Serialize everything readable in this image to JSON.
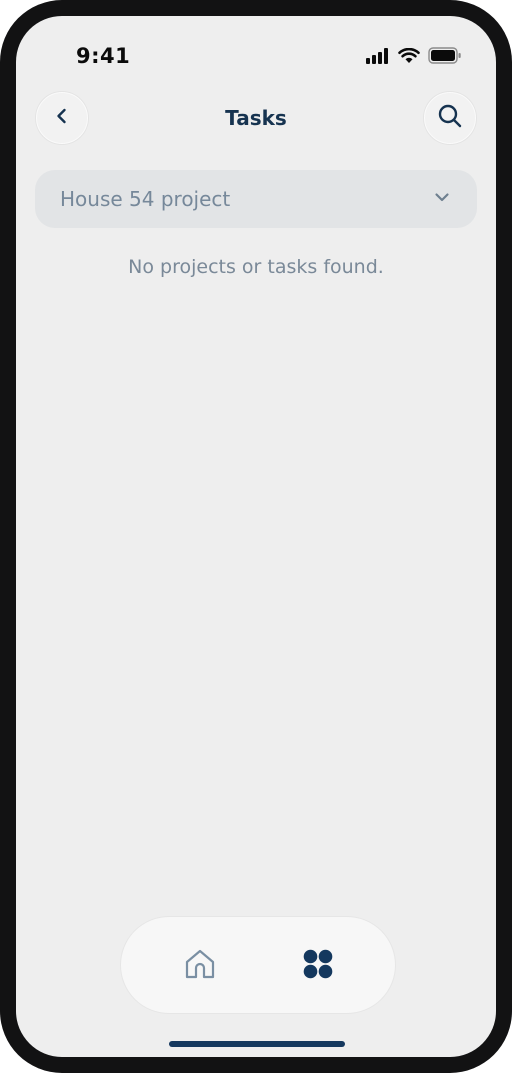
{
  "status_bar": {
    "time": "9:41",
    "icons": [
      "cellular-signal-icon",
      "wifi-icon",
      "battery-icon"
    ]
  },
  "header": {
    "title": "Tasks",
    "back_icon": "chevron-left-icon",
    "search_icon": "search-icon"
  },
  "project_select": {
    "selected": "House 54 project",
    "icon": "chevron-down-icon"
  },
  "empty_state": {
    "message": "No projects or tasks found."
  },
  "bottom_nav": {
    "items": [
      {
        "icon": "home-icon",
        "active": false
      },
      {
        "icon": "apps-grid-icon",
        "active": true
      }
    ]
  },
  "colors": {
    "title": "#163350",
    "accent": "#14385e",
    "muted_text": "#76889a",
    "screen_bg": "#eeeeee",
    "select_bg": "#e2e4e6"
  }
}
